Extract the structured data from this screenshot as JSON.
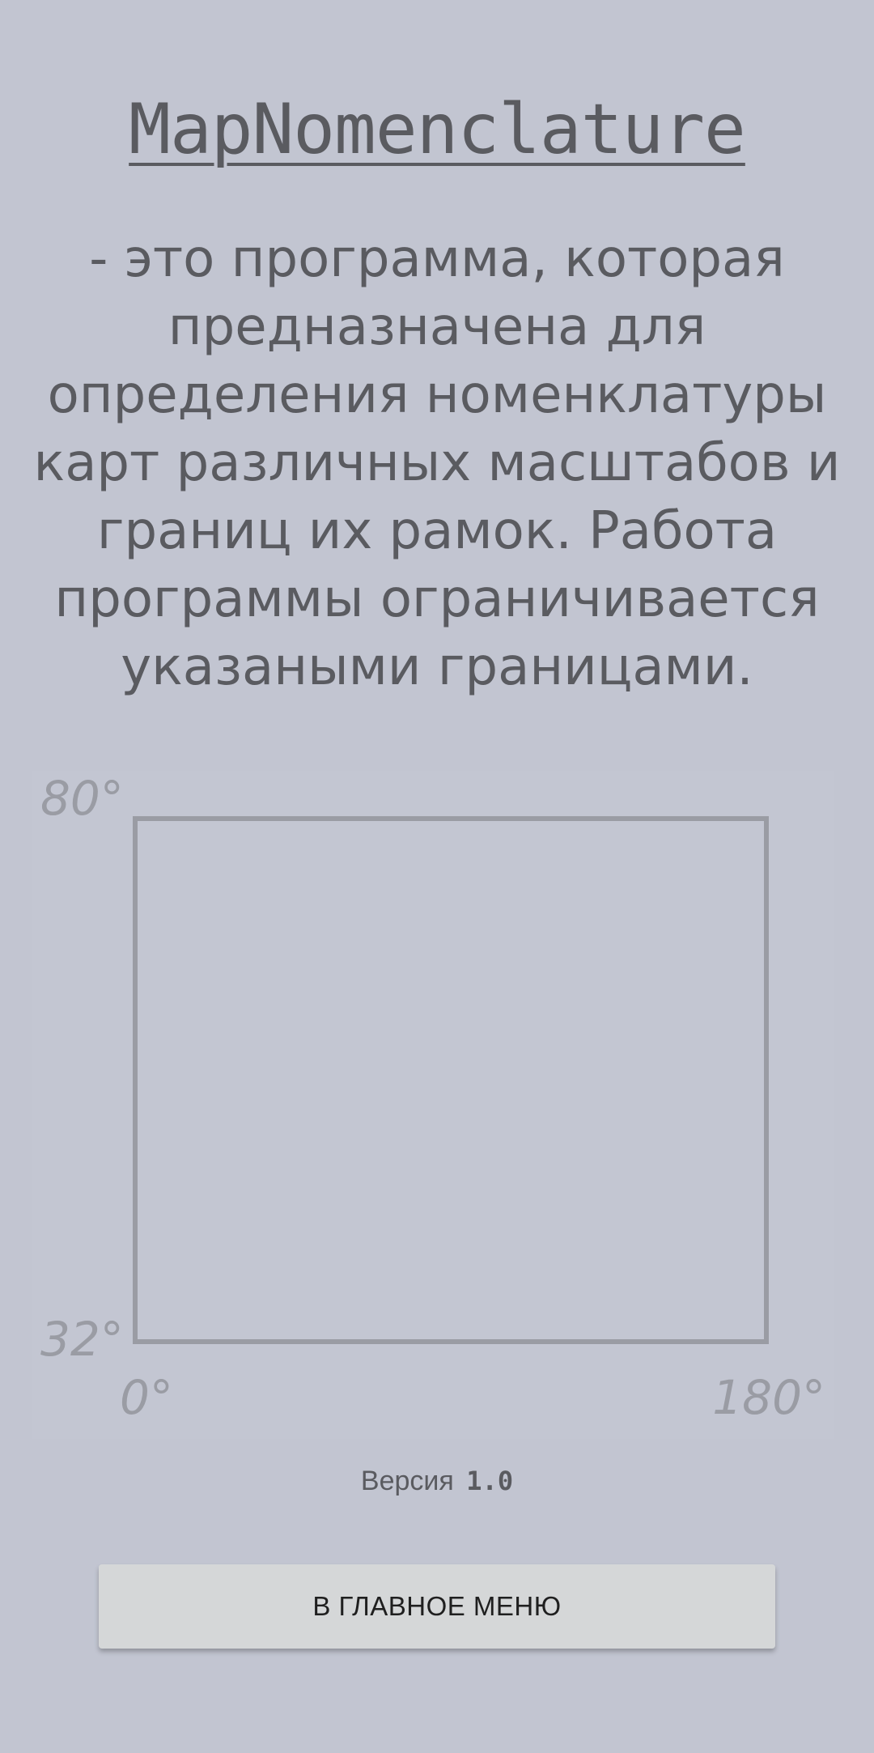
{
  "app": {
    "title": "MapNomenclature",
    "description": "- это программа, которая предназначена для определения номенклатуры карт различных масштабов и границ их рамок. Работа программы ограничивается указаными границами."
  },
  "coverage_diagram": {
    "lat_top_label": "80°",
    "lat_bottom_label": "32°",
    "lon_left_label": "0°",
    "lon_right_label": "180°",
    "frame_color": "#9a9ca4"
  },
  "version": {
    "label": "Версия",
    "number": "1.0"
  },
  "buttons": {
    "main_menu_label": "В ГЛАВНОЕ МЕНЮ"
  },
  "colors": {
    "background": "#c2c5d1",
    "text": "#5a5b60",
    "button_bg": "#d5d7d8"
  }
}
